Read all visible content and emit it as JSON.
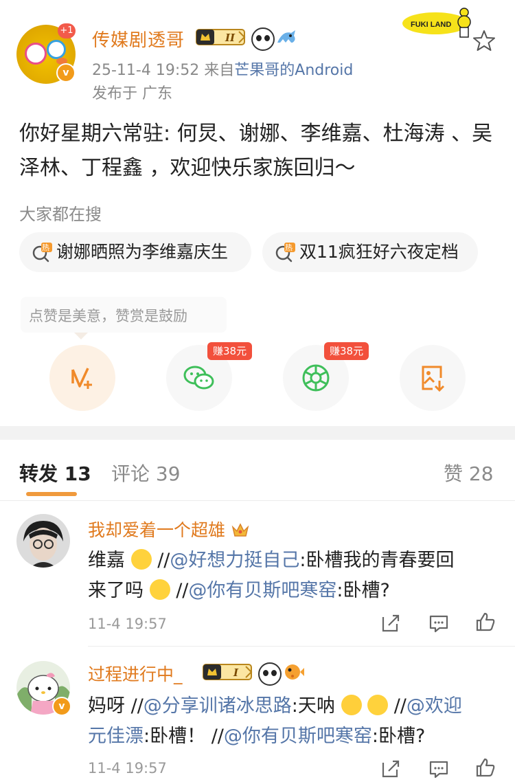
{
  "post": {
    "author": "传媒剧透哥",
    "avatar_badge": "+1",
    "level_badge": "II",
    "time": "25-11-4 19:52",
    "source_prefix": "来自",
    "source": "芒果哥的Android",
    "location": "发布于 广东",
    "sticker_text": "FUKI LAND",
    "text": "你好星期六常驻: 何炅、谢娜、李维嘉、杜海涛 、吴泽林、丁程鑫 ，欢迎快乐家族回归～"
  },
  "search": {
    "title": "大家都在搜",
    "chips": [
      "谢娜晒照为李维嘉庆生",
      "双11疯狂好六夜定档"
    ],
    "hot_label": "热"
  },
  "actions": {
    "tip": "点赞是美意，赞赏是鼓励",
    "earn_label": "赚38元",
    "icons": [
      "vip-plus-icon",
      "wechat-icon",
      "moments-icon",
      "save-image-icon"
    ]
  },
  "tabs": {
    "forward": "转发 13",
    "comment": "评论 39",
    "like": "赞 28"
  },
  "comments": [
    {
      "name": "我却爱着一个超雄",
      "line1_pre": "维嘉",
      "line1_sep": "//",
      "line1_at": "@好想力挺自己",
      "line1_rest": ":卧槽我的青春要回",
      "line2_pre": "来了吗",
      "line2_sep": "//",
      "line2_at": "@你有贝斯吧寒窑",
      "line2_rest": ":卧槽?",
      "time": "11-4 19:57"
    },
    {
      "name": "过程进行中_",
      "level_badge": "I",
      "line1_pre": "妈呀 ",
      "line1_sep": "//",
      "line1_at": "@分享训诸冰思路",
      "line1_rest": ":天呐",
      "line1_sep2": "//",
      "line1_at2": "@欢迎",
      "line2_at": "元佳漂",
      "line2_rest": ":卧槽！ ",
      "line2_sep": "//",
      "line2_at2": "@你有贝斯吧寒窑",
      "line2_rest2": ":卧槽?",
      "time": "11-4 19:57"
    }
  ],
  "colors": {
    "accent_orange": "#e07a1e",
    "link_blue": "#5576a8",
    "earn_red": "#f2503c",
    "wechat_green": "#3fbf5a"
  }
}
